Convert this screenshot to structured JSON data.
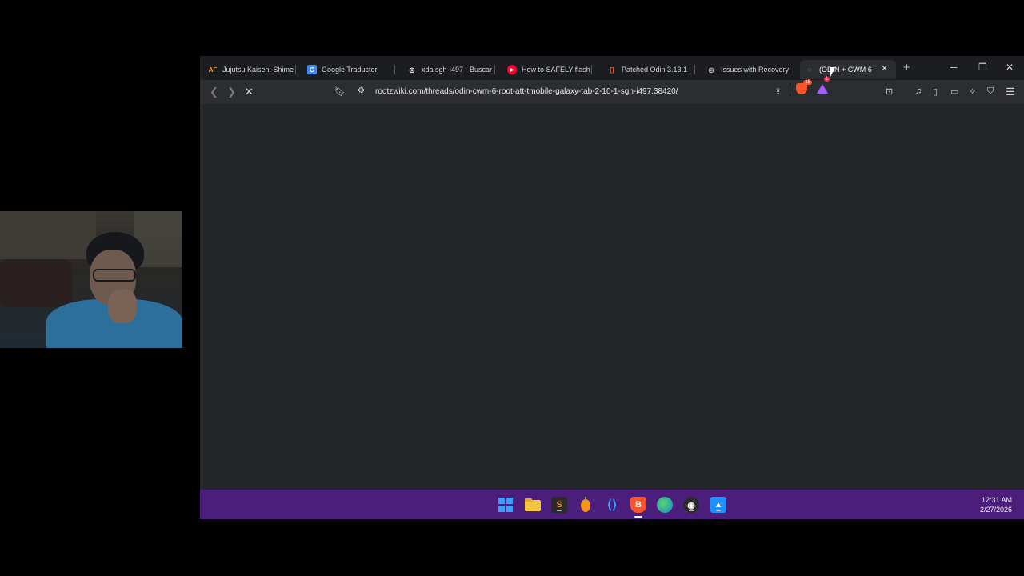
{
  "tabs": [
    {
      "title": "Jujutsu Kaisen: Shime",
      "icon": "animeflv-icon",
      "fav_text": "AF",
      "color": "#f2a33a"
    },
    {
      "title": "Google Traductor",
      "icon": "google-translate-icon",
      "fav_text": "G",
      "color": "#4285f4"
    },
    {
      "title": "xda sgh-I497 - Buscar",
      "icon": "chatgpt-icon",
      "fav_text": "◎",
      "color": "#ffffff"
    },
    {
      "title": "How to SAFELY flash a",
      "icon": "youtube-icon",
      "fav_text": "▶",
      "color": "#ff0033"
    },
    {
      "title": "Patched Odin 3.13.1 |",
      "icon": "xda-icon",
      "fav_text": "[]",
      "color": "#f0592b"
    },
    {
      "title": "Issues with Recovery",
      "icon": "forum-icon",
      "fav_text": "◎",
      "color": "#cccccc"
    },
    {
      "title": "(ODIN + CWM 6",
      "icon": "loading-icon",
      "fav_text": "◌",
      "color": "#cccccc"
    }
  ],
  "toolbar": {
    "url": "rootzwiki.com/threads/odin-cwm-6-root-att-tmobile-galaxy-tab-2-10-1-sgh-i497.38420/",
    "brave_shield_count": "15",
    "rewards_count": "1"
  },
  "taskbar": {
    "time": "12:31 AM",
    "date": "2/27/2026"
  },
  "colors": {
    "taskbar": "#4a1e7a",
    "browser_bg": "#242628",
    "tabbar_bg": "#1c1d20"
  }
}
